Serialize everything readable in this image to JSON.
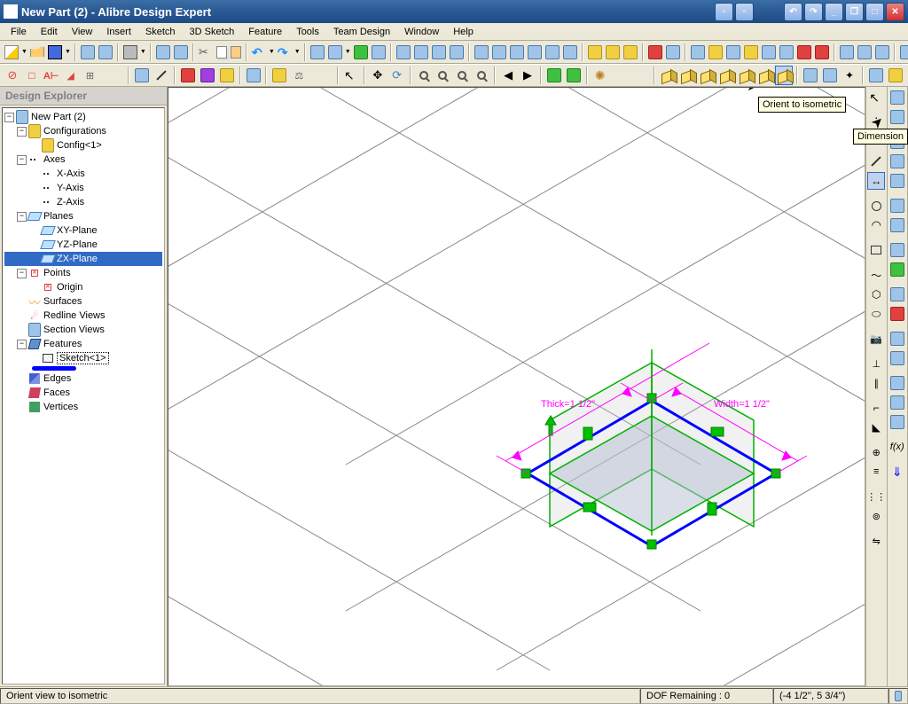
{
  "window": {
    "title": "New Part (2) - Alibre Design Expert"
  },
  "menu": {
    "file": "File",
    "edit": "Edit",
    "view": "View",
    "insert": "Insert",
    "sketch": "Sketch",
    "sketch3d": "3D Sketch",
    "feature": "Feature",
    "tools": "Tools",
    "team": "Team Design",
    "window": "Window",
    "help": "Help"
  },
  "tooltips": {
    "isometric": "Orient to isometric",
    "dimension": "Dimension"
  },
  "explorer": {
    "title": "Design Explorer",
    "root": "New Part (2)",
    "configurations": "Configurations",
    "config1": "Config<1>",
    "axes": "Axes",
    "xaxis": "X-Axis",
    "yaxis": "Y-Axis",
    "zaxis": "Z-Axis",
    "planes": "Planes",
    "xyplane": "XY-Plane",
    "yzplane": "YZ-Plane",
    "zxplane": "ZX-Plane",
    "points": "Points",
    "origin": "Origin",
    "surfaces": "Surfaces",
    "redline": "Redline Views",
    "section": "Section Views",
    "features": "Features",
    "sketch1": "Sketch<1>",
    "edges": "Edges",
    "faces": "Faces",
    "vertices": "Vertices"
  },
  "dimensions": {
    "thick": "Thick=1 1/2\"",
    "width": "Width=1 1/2\""
  },
  "status": {
    "hint": "Orient view to isometric",
    "dof": "DOF Remaining : 0",
    "coords": "(-4 1/2'', 5 3/4'')"
  }
}
